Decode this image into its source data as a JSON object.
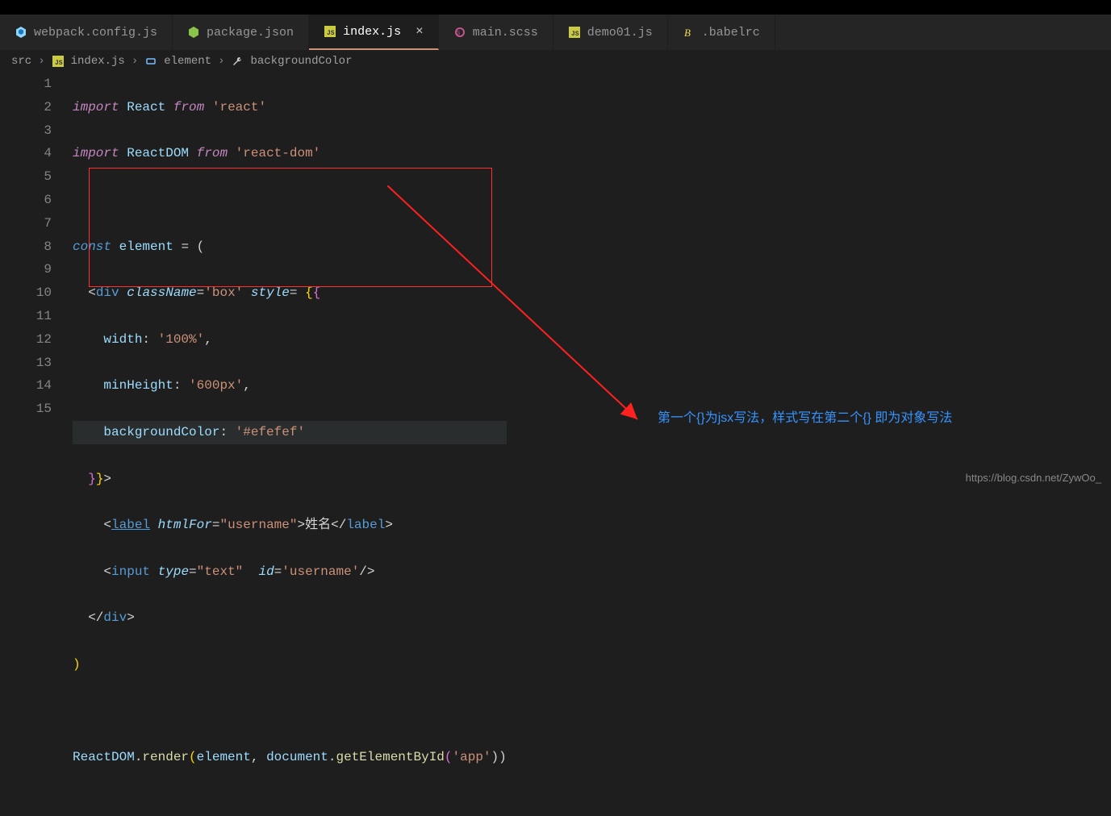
{
  "tabs": [
    {
      "label": "webpack.config.js",
      "icon": "#519aba",
      "iconType": "webpack"
    },
    {
      "label": "package.json",
      "icon": "#8bc34a",
      "iconType": "node"
    },
    {
      "label": "index.js",
      "icon": "#cbcb41",
      "iconType": "js",
      "active": true
    },
    {
      "label": "main.scss",
      "icon": "#c6538c",
      "iconType": "sass"
    },
    {
      "label": "demo01.js",
      "icon": "#cbcb41",
      "iconType": "js"
    },
    {
      "label": ".babelrc",
      "icon": "#f5da55",
      "iconType": "babel"
    }
  ],
  "breadcrumbs": {
    "items": [
      {
        "label": "src"
      },
      {
        "label": "index.js",
        "icon": "js"
      },
      {
        "label": "element",
        "icon": "symbol"
      },
      {
        "label": "backgroundColor",
        "icon": "wrench"
      }
    ]
  },
  "code": {
    "l1": {
      "import": "import",
      "React": "React",
      "from": "from",
      "react": "'react'"
    },
    "l2": {
      "import": "import",
      "ReactDOM": "ReactDOM",
      "from": "from",
      "reactdom": "'react-dom'"
    },
    "l4": {
      "const": "const",
      "element": "element",
      "eq": " = (",
      "paren": "("
    },
    "l5": {
      "open": "<",
      "div": "div",
      "className": "className",
      "eq1": "=",
      "box": "'box'",
      "style": "style",
      "eq2": "= ",
      "br1": "{",
      "br2": "{"
    },
    "l6": {
      "key": "width",
      "colon": ": ",
      "val": "'100%'",
      "comma": ","
    },
    "l7": {
      "key": "minHeight",
      "colon": ": ",
      "val": "'600px'",
      "comma": ","
    },
    "l8": {
      "key": "backgroundColor",
      "colon": ": ",
      "val": "'#efefef'"
    },
    "l9": {
      "br1": "}",
      "br2": "}",
      "close": ">"
    },
    "l10": {
      "open": "<",
      "label": "label",
      "htmlFor": "htmlFor",
      "eq": "=",
      "username": "\"username\"",
      "close1": ">",
      "text": "姓名",
      "close2": "</",
      "label2": "label",
      "close3": ">"
    },
    "l11": {
      "open": "<",
      "input": "input",
      "type": "type",
      "eq1": "=",
      "text": "\"text\"",
      "id": "id",
      "eq2": "=",
      "username": "'username'",
      "close": "/>"
    },
    "l12": {
      "close": "</",
      "div": "div",
      "close2": ">"
    },
    "l13": {
      "paren": ")"
    },
    "l15": {
      "ReactDOM": "ReactDOM",
      "dot": ".",
      "render": "render",
      "open": "(",
      "element": "element",
      "comma": ", ",
      "document": "document",
      "dot2": ".",
      "getById": "getElementById",
      "open2": "(",
      "app": "'app'",
      "close": "))"
    }
  },
  "lines": [
    "1",
    "2",
    "3",
    "4",
    "5",
    "6",
    "7",
    "8",
    "9",
    "10",
    "11",
    "12",
    "13",
    "14",
    "15"
  ],
  "annotation": "第一个{}为jsx写法，样式写在第二个{} 即为对象写法",
  "watermark": "https://blog.csdn.net/ZywOo_"
}
